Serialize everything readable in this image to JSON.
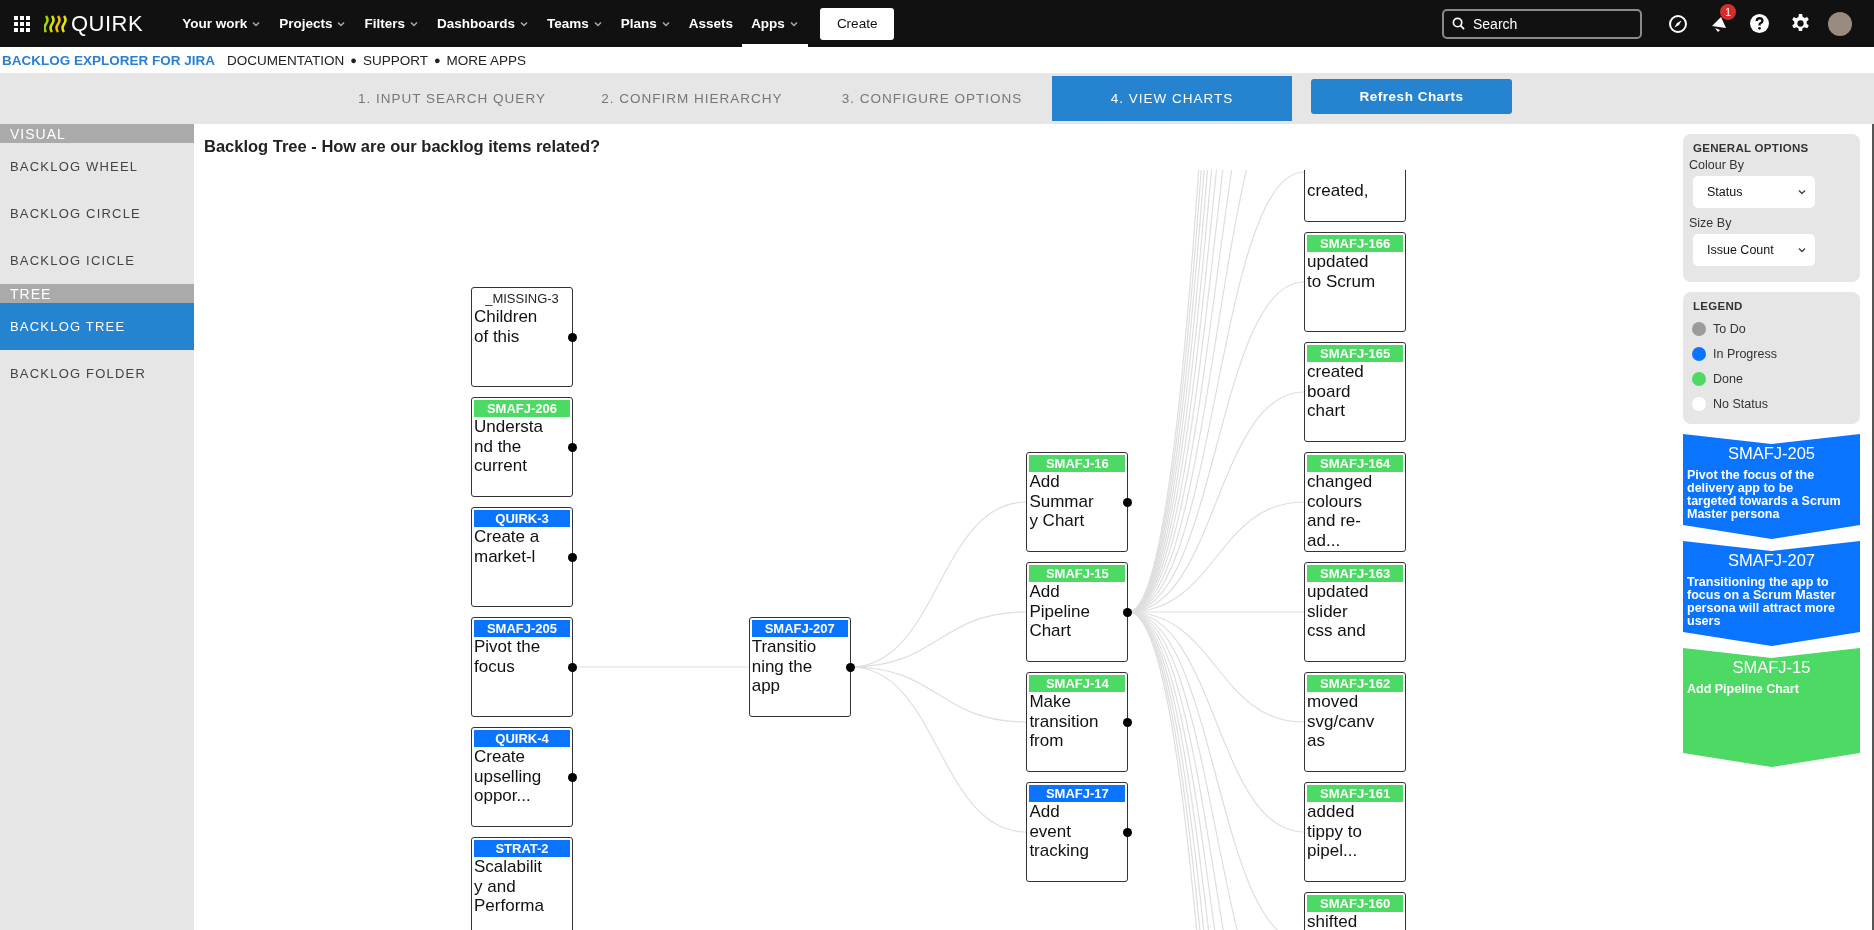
{
  "topbar": {
    "logo": "QUIRK",
    "menu": [
      {
        "label": "Your work",
        "dropdown": true,
        "selected": false
      },
      {
        "label": "Projects",
        "dropdown": true,
        "selected": false
      },
      {
        "label": "Filters",
        "dropdown": true,
        "selected": false
      },
      {
        "label": "Dashboards",
        "dropdown": true,
        "selected": false
      },
      {
        "label": "Teams",
        "dropdown": true,
        "selected": false
      },
      {
        "label": "Plans",
        "dropdown": true,
        "selected": false
      },
      {
        "label": "Assets",
        "dropdown": false,
        "selected": false
      },
      {
        "label": "Apps",
        "dropdown": true,
        "selected": true
      }
    ],
    "create_button": "Create",
    "search": {
      "placeholder": "Search"
    },
    "notification_count": "1"
  },
  "subheader": {
    "title": "BACKLOG EXPLORER FOR JIRA",
    "items": [
      {
        "kind": "link",
        "text": "DOCUMENTATION"
      },
      {
        "kind": "separator",
        "text": "●"
      },
      {
        "kind": "link",
        "text": "SUPPORT"
      },
      {
        "kind": "separator",
        "text": "●"
      },
      {
        "kind": "link",
        "text": "MORE APPS"
      }
    ]
  },
  "steps": [
    {
      "label": "1. INPUT SEARCH QUERY",
      "selected": false
    },
    {
      "label": "2. CONFIRM HIERARCHY",
      "selected": false
    },
    {
      "label": "3. CONFIGURE OPTIONS",
      "selected": false
    },
    {
      "label": "4. VIEW CHARTS",
      "selected": true
    }
  ],
  "refresh_button": "Refresh Charts",
  "sidebar": {
    "sections": [
      {
        "title": "VISUAL",
        "items": [
          {
            "label": "BACKLOG WHEEL",
            "selected": false
          },
          {
            "label": "BACKLOG CIRCLE",
            "selected": false
          },
          {
            "label": "BACKLOG ICICLE",
            "selected": false
          }
        ]
      },
      {
        "title": "TREE",
        "items": [
          {
            "label": "BACKLOG TREE",
            "selected": true
          },
          {
            "label": "BACKLOG FOLDER",
            "selected": false
          }
        ]
      }
    ]
  },
  "chart": {
    "title": "Backlog Tree - How are our backlog items related?",
    "nodes": [
      {
        "id": "_MISSING-3",
        "text": "Children of this",
        "color": "#ffffff",
        "expandable": true
      },
      {
        "id": "SMAFJ-206",
        "text": "Understand the current",
        "color": "#4cd964",
        "expandable": true
      },
      {
        "id": "QUIRK-3",
        "text": "Create a market-l",
        "color": "#0a74ff",
        "expandable": true
      },
      {
        "id": "SMAFJ-205",
        "text": "Pivot the focus",
        "color": "#0a74ff",
        "expandable": true,
        "children": [
          {
            "id": "SMAFJ-207",
            "text": "Transitioning the app",
            "color": "#0a74ff",
            "expandable": true,
            "children": [
              {
                "id": "SMAFJ-16",
                "text": "Add Summary Chart",
                "color": "#4cd964",
                "expandable": true
              },
              {
                "id": "SMAFJ-15",
                "text": "Add Pipeline Chart",
                "color": "#4cd964",
                "expandable": true,
                "more_children": true,
                "children": [
                  {
                    "text": "created,"
                  },
                  {
                    "id": "SMAFJ-166",
                    "text": "updated to Scrum",
                    "color": "#4cd964",
                    "expandable": false
                  },
                  {
                    "id": "SMAFJ-165",
                    "text": "created board chart",
                    "color": "#4cd964",
                    "expandable": false
                  },
                  {
                    "id": "SMAFJ-164",
                    "text": "changed colours and re-ad...",
                    "color": "#4cd964",
                    "expandable": false
                  },
                  {
                    "id": "SMAFJ-163",
                    "text": "updated slider css and",
                    "color": "#4cd964",
                    "expandable": false
                  },
                  {
                    "id": "SMAFJ-162",
                    "text": "moved svg/canvas",
                    "color": "#4cd964",
                    "expandable": false
                  },
                  {
                    "id": "SMAFJ-161",
                    "text": "added tippy to pipel...",
                    "color": "#4cd964",
                    "expandable": false
                  },
                  {
                    "id": "SMAFJ-160",
                    "text": "shifted",
                    "color": "#4cd964",
                    "expandable": false
                  }
                ]
              },
              {
                "id": "SMAFJ-14",
                "text": "Make transition from",
                "color": "#4cd964",
                "expandable": true
              },
              {
                "id": "SMAFJ-17",
                "text": "Add event tracking",
                "color": "#0a74ff",
                "expandable": true
              }
            ]
          }
        ]
      },
      {
        "id": "QUIRK-4",
        "text": "Create upselling oppor...",
        "color": "#0a74ff",
        "expandable": true
      },
      {
        "id": "STRAT-2",
        "text": "Scalability and Performa",
        "color": "#0a74ff",
        "expandable": false
      }
    ]
  },
  "options": {
    "title": "GENERAL OPTIONS",
    "fields": [
      {
        "label": "Colour By",
        "value": "Status"
      },
      {
        "label": "Size By",
        "value": "Issue Count"
      }
    ]
  },
  "legend": {
    "title": "LEGEND",
    "items": [
      {
        "label": "To Do",
        "color": "#9b9b9b"
      },
      {
        "label": "In Progress",
        "color": "#0a74ff"
      },
      {
        "label": "Done",
        "color": "#4cd964"
      },
      {
        "label": "No Status",
        "color": "#ffffff"
      }
    ]
  },
  "path": [
    {
      "id": "SMAFJ-205",
      "text": "Pivot the focus of the delivery app to be targeted towards a Scrum Master persona",
      "color": "#0a74ff"
    },
    {
      "id": "SMAFJ-207",
      "text": "Transitioning the app to focus on a Scrum Master persona will attract more users",
      "color": "#0a74ff"
    },
    {
      "id": "SMAFJ-15",
      "text": "Add Pipeline Chart",
      "color": "#4cd964"
    }
  ]
}
